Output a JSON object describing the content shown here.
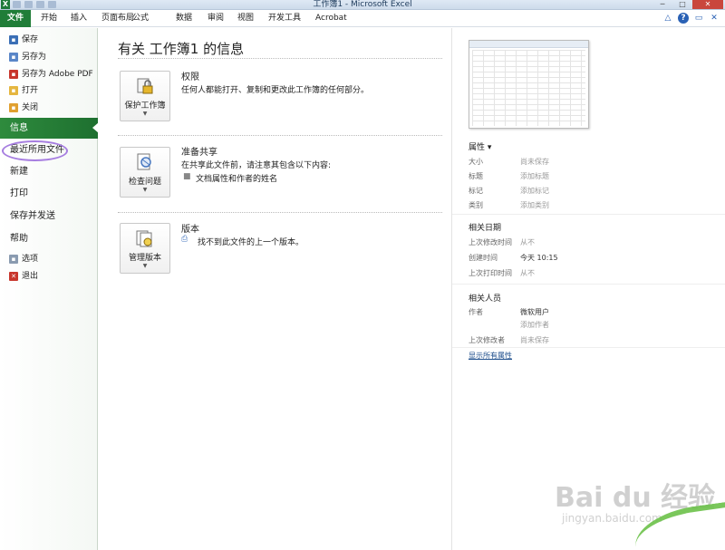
{
  "window": {
    "title": "工作簿1 - Microsoft Excel",
    "app_icon": "X"
  },
  "ribbon": {
    "tabs": [
      {
        "label": "文件",
        "active": true
      },
      {
        "label": "开始"
      },
      {
        "label": "插入"
      },
      {
        "label": "页面布局"
      },
      {
        "label": "公式"
      },
      {
        "label": "数据"
      },
      {
        "label": "审阅"
      },
      {
        "label": "视图"
      },
      {
        "label": "开发工具"
      },
      {
        "label": "Acrobat"
      }
    ]
  },
  "nav": {
    "save": "保存",
    "save_as": "另存为",
    "save_as_pdf": "另存为 Adobe PDF",
    "open": "打开",
    "close": "关闭",
    "info": "信息",
    "recent": "最近所用文件",
    "new": "新建",
    "print": "打印",
    "save_send": "保存并发送",
    "help": "帮助",
    "options": "选项",
    "exit": "退出"
  },
  "main": {
    "title": "有关 工作簿1 的信息",
    "permissions": {
      "button": "保护工作簿",
      "title": "权限",
      "desc": "任何人都能打开、复制和更改此工作簿的任何部分。"
    },
    "prepare": {
      "button": "检查问题",
      "title": "准备共享",
      "desc": "在共享此文件前，请注意其包含以下内容:",
      "item": "文档属性和作者的姓名"
    },
    "versions": {
      "button": "管理版本",
      "title": "版本",
      "desc": "找不到此文件的上一个版本。"
    }
  },
  "props": {
    "header": "属性 ▾",
    "rows": [
      {
        "label": "大小",
        "value": "尚未保存"
      },
      {
        "label": "标题",
        "value": "添加标题"
      },
      {
        "label": "标记",
        "value": "添加标记"
      },
      {
        "label": "类别",
        "value": "添加类别"
      }
    ],
    "dates_header": "相关日期",
    "dates": [
      {
        "label": "上次修改时间",
        "value": "从不"
      },
      {
        "label": "创建时间",
        "value": "今天 10:15"
      },
      {
        "label": "上次打印时间",
        "value": "从不"
      }
    ],
    "people_header": "相关人员",
    "author_label": "作者",
    "author_value": "微软用户",
    "add_author": "添加作者",
    "modified_by_label": "上次修改者",
    "modified_by_value": "尚未保存",
    "show_all": "显示所有属性"
  },
  "watermark": {
    "main": "Bai du 经验",
    "sub": "jingyan.baidu.com"
  }
}
